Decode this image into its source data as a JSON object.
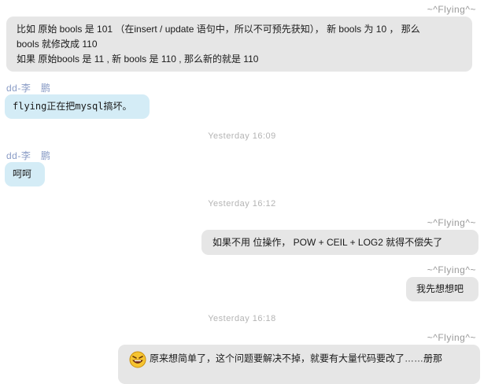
{
  "messages": [
    {
      "sender": "~^Flying^~",
      "lines": [
        "比如 原始 bools 是 101 （在insert / update 语句中，所以不可预先获知）， 新 bools 为 10 ， 那么",
        "bools 就修改成  110",
        "如果 原始bools 是 11 , 新 bools 是 110 , 那么新的就是 110"
      ]
    },
    {
      "sender": "dd-李　鹏",
      "text": "flying正在把mysql搞坏。"
    },
    {
      "time": "Yesterday  16:09"
    },
    {
      "sender": "dd-李　鹏",
      "text": "呵呵"
    },
    {
      "time": "Yesterday  16:12"
    },
    {
      "sender": "~^Flying^~",
      "text": "如果不用 位操作，  POW + CEIL + LOG2  就得不偿失了"
    },
    {
      "sender": "~^Flying^~",
      "text": "我先想想吧"
    },
    {
      "time": "Yesterday  16:18"
    },
    {
      "sender": "~^Flying^~",
      "text": "原来想简单了，这个问题要解决不掉，就要有大量代码要改了……册那",
      "icon": "laughing-emoji-icon"
    }
  ]
}
